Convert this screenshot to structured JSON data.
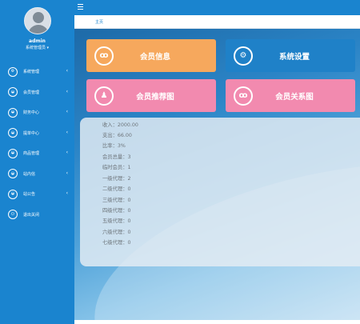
{
  "user": {
    "name": "admin",
    "role": "系统管理员 ▾"
  },
  "sidebar": {
    "items": [
      {
        "label": "系统管理",
        "icon": "gear-icon",
        "glyph": "⚙"
      },
      {
        "label": "会员管理",
        "icon": "car-icon",
        "glyph": "◒"
      },
      {
        "label": "财务中心",
        "icon": "car-icon",
        "glyph": "◒"
      },
      {
        "label": "提单中心",
        "icon": "car-icon",
        "glyph": "◒"
      },
      {
        "label": "商品管理",
        "icon": "car-icon",
        "glyph": "◒"
      },
      {
        "label": "站内信",
        "icon": "car-icon",
        "glyph": "◒"
      },
      {
        "label": "站公告",
        "icon": "car-icon",
        "glyph": "◒"
      },
      {
        "label": "退出关闭",
        "icon": "power-icon",
        "glyph": "⏻"
      }
    ]
  },
  "breadcrumb": "主页",
  "tiles": [
    {
      "label": "会员信息",
      "icon": "users-icon",
      "glyph": "ꝏ",
      "color": "#f6a85d"
    },
    {
      "label": "系统设置",
      "icon": "gear-icon",
      "glyph": "⚙",
      "color": "#1f81c8"
    },
    {
      "label": "会员推荐图",
      "icon": "user-icon",
      "glyph": "♟",
      "color": "#f28aaf"
    },
    {
      "label": "会员关系图",
      "icon": "users-icon",
      "glyph": "ꝏ",
      "color": "#f28aaf"
    }
  ],
  "stats": [
    {
      "label": "收入：",
      "value": "2000.00"
    },
    {
      "label": "支出：",
      "value": "66.00"
    },
    {
      "label": "比率：",
      "value": "3%"
    },
    {
      "label": "会员总量：",
      "value": "3"
    },
    {
      "label": "临时会员：",
      "value": "1"
    },
    {
      "label": "一级代理：",
      "value": "2"
    },
    {
      "label": "二级代理：",
      "value": "0"
    },
    {
      "label": "三级代理：",
      "value": "0"
    },
    {
      "label": "四级代理：",
      "value": "0"
    },
    {
      "label": "五级代理：",
      "value": "0"
    },
    {
      "label": "六级代理：",
      "value": "0"
    },
    {
      "label": "七级代理：",
      "value": "0"
    }
  ]
}
